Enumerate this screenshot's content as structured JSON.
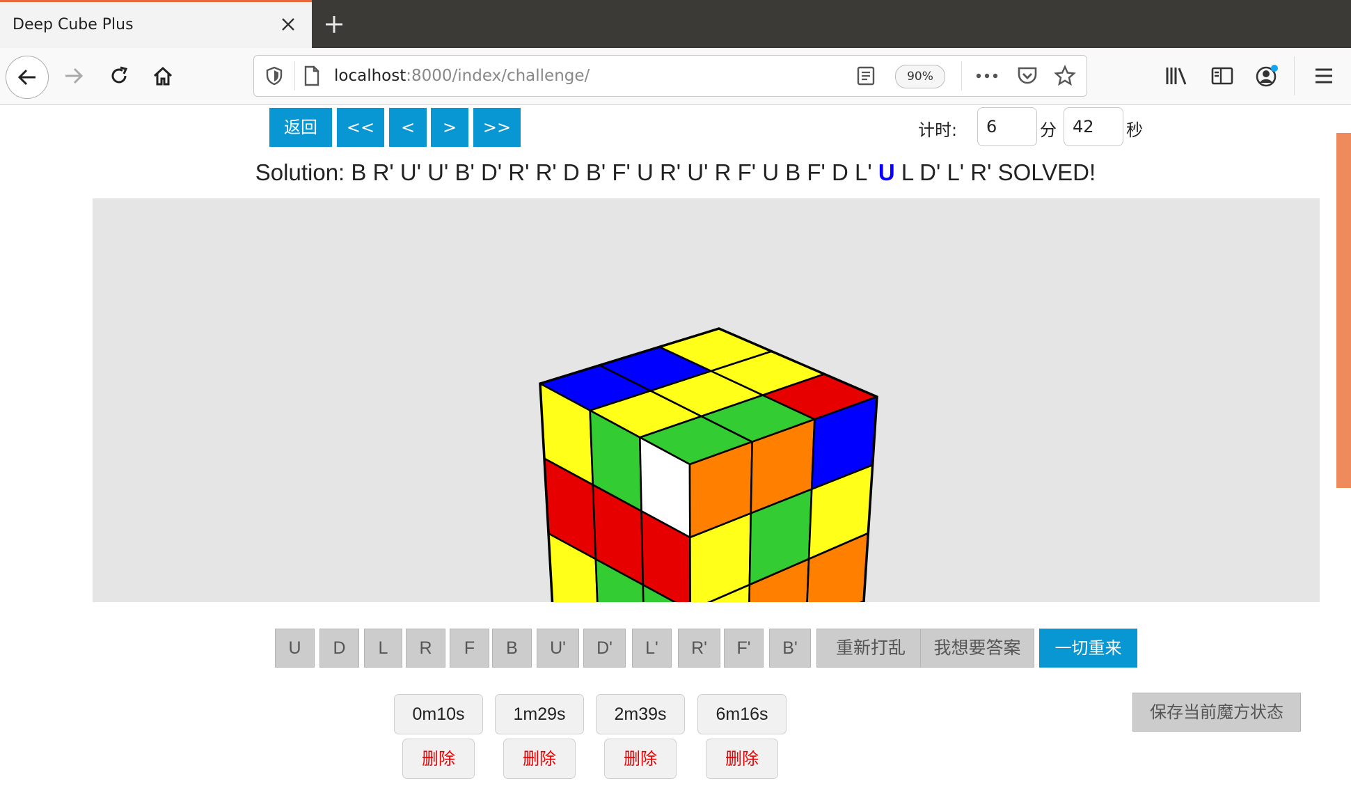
{
  "browser": {
    "tab_title": "Deep Cube Plus",
    "url_host": "localhost",
    "url_rest": ":8000/index/challenge/",
    "zoom": "90%"
  },
  "toolbar": {
    "back_label": "返回",
    "first_label": "<<",
    "prev_label": "<",
    "next_label": ">",
    "last_label": ">>",
    "timer_label": "计时:",
    "minutes": "6",
    "minutes_unit": "分",
    "seconds": "42",
    "seconds_unit": "秒"
  },
  "solution": {
    "prefix": "Solution:",
    "before_current": "B R' U' U' B' D' R' R' D B' F' U R' U' R F' U B F' D L'",
    "current": "U",
    "after_current": "L D' L' R' SOLVED!"
  },
  "cube": {
    "colors": {
      "yellow": "#ffff1a",
      "green": "#33cc33",
      "red": "#e60000",
      "orange": "#ff8000",
      "blue": "#0000ff",
      "white": "#ffffff",
      "background": "#e5e5e5"
    },
    "top_face": [
      [
        "blue",
        "blue",
        "yellow"
      ],
      [
        "yellow",
        "yellow",
        "yellow"
      ],
      [
        "green",
        "green",
        "red"
      ]
    ],
    "left_face": [
      [
        "yellow",
        "green",
        "white"
      ],
      [
        "red",
        "red",
        "red"
      ],
      [
        "yellow",
        "green",
        "green"
      ]
    ],
    "right_face": [
      [
        "orange",
        "orange",
        "blue"
      ],
      [
        "yellow",
        "green",
        "yellow"
      ],
      [
        "yellow",
        "orange",
        "orange"
      ]
    ]
  },
  "moves": [
    "U",
    "D",
    "L",
    "R",
    "F",
    "B",
    "U'",
    "D'",
    "L'",
    "R'",
    "F'",
    "B'"
  ],
  "actions": {
    "rescramble": "重新打乱",
    "want_answer": "我想要答案",
    "reset_all": "一切重来"
  },
  "records": [
    {
      "time": "0m10s",
      "delete": "删除"
    },
    {
      "time": "1m29s",
      "delete": "删除"
    },
    {
      "time": "2m39s",
      "delete": "删除"
    },
    {
      "time": "6m16s",
      "delete": "删除"
    }
  ],
  "save_state": "保存当前魔方状态"
}
